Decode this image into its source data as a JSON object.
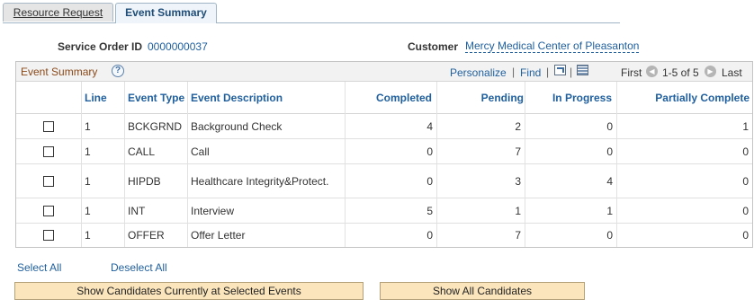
{
  "tabs": [
    {
      "label": "Resource Request",
      "active": false
    },
    {
      "label": "Event Summary",
      "active": true
    }
  ],
  "header": {
    "service_order_label": "Service Order ID",
    "service_order_value": "0000000037",
    "customer_label": "Customer",
    "customer_value": "Mercy Medical Center of Pleasanton"
  },
  "grid": {
    "title": "Event Summary",
    "help_glyph": "?",
    "personalize": "Personalize",
    "divider": "|",
    "find": "Find",
    "first": "First",
    "range": "1-5 of 5",
    "last": "Last",
    "columns": {
      "line": "Line",
      "event_type": "Event Type",
      "event_description": "Event Description",
      "completed": "Completed",
      "pending": "Pending",
      "in_progress": "In Progress",
      "partially_complete": "Partially Complete"
    },
    "rows": [
      {
        "line": "1",
        "event_type": "BCKGRND",
        "event_description": "Background Check",
        "completed": "4",
        "pending": "2",
        "in_progress": "0",
        "partially_complete": "1"
      },
      {
        "line": "1",
        "event_type": "CALL",
        "event_description": "Call",
        "completed": "0",
        "pending": "7",
        "in_progress": "0",
        "partially_complete": "0"
      },
      {
        "line": "1",
        "event_type": "HIPDB",
        "event_description": "Healthcare Integrity&Protect.",
        "completed": "0",
        "pending": "3",
        "in_progress": "4",
        "partially_complete": "0"
      },
      {
        "line": "1",
        "event_type": "INT",
        "event_description": "Interview",
        "completed": "5",
        "pending": "1",
        "in_progress": "1",
        "partially_complete": "0"
      },
      {
        "line": "1",
        "event_type": "OFFER",
        "event_description": "Offer Letter",
        "completed": "0",
        "pending": "7",
        "in_progress": "0",
        "partially_complete": "0"
      }
    ]
  },
  "actions": {
    "select_all": "Select All",
    "deselect_all": "Deselect All",
    "show_selected": "Show Candidates Currently at Selected Events",
    "show_all": "Show All Candidates"
  },
  "icons": {
    "help": "help-icon",
    "zoom": "zoom-grid-icon",
    "download": "download-spreadsheet-icon",
    "prev": "previous-arrow-icon",
    "next": "next-arrow-icon"
  }
}
